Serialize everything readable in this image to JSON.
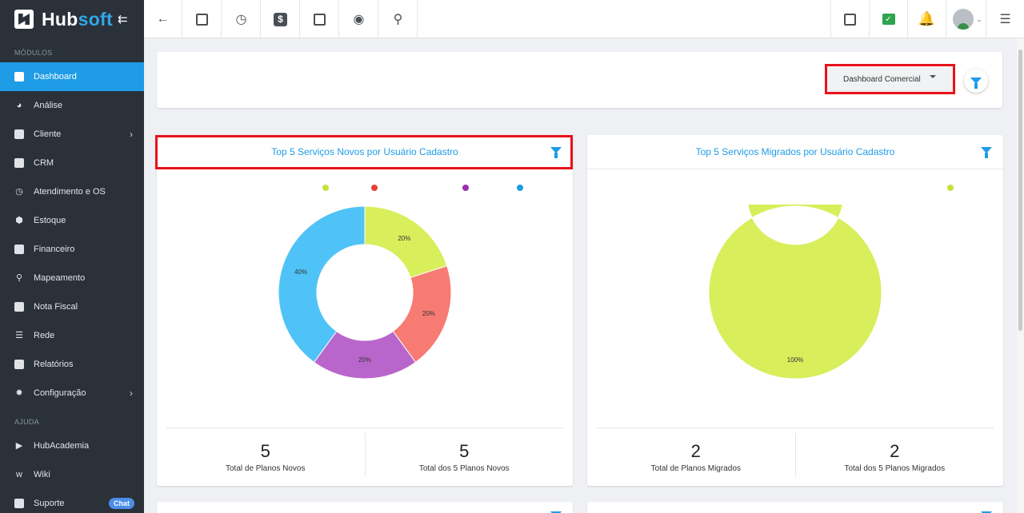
{
  "brand": {
    "name_part1": "Hub",
    "name_part2": "soft"
  },
  "sidebar": {
    "section_modules": "MÓDULOS",
    "section_help": "AJUDA",
    "items": [
      {
        "label": "Dashboard",
        "icon": "dashboard-icon"
      },
      {
        "label": "Análise",
        "icon": "pie-chart-icon"
      },
      {
        "label": "Cliente",
        "icon": "contact-card-icon"
      },
      {
        "label": "CRM",
        "icon": "crm-icon"
      },
      {
        "label": "Atendimento e OS",
        "icon": "calendar-clock-icon"
      },
      {
        "label": "Estoque",
        "icon": "box-icon"
      },
      {
        "label": "Financeiro",
        "icon": "money-icon"
      },
      {
        "label": "Mapeamento",
        "icon": "map-pin-icon"
      },
      {
        "label": "Nota Fiscal",
        "icon": "invoice-icon"
      },
      {
        "label": "Rede",
        "icon": "server-icon"
      },
      {
        "label": "Relatórios",
        "icon": "report-icon"
      },
      {
        "label": "Configuração",
        "icon": "gear-icon"
      }
    ],
    "help_items": [
      {
        "label": "HubAcademia",
        "icon": "video-icon"
      },
      {
        "label": "Wiki",
        "icon": "wiki-icon"
      },
      {
        "label": "Suporte",
        "icon": "chat-icon",
        "badge": "Chat"
      }
    ]
  },
  "filter": {
    "dashboard_select": "Dashboard Comercial"
  },
  "cards": [
    {
      "title": "Top 5 Serviços Novos por Usuário Cadastro",
      "stats": [
        {
          "value": "5",
          "label": "Total de Planos Novos"
        },
        {
          "value": "5",
          "label": "Total dos 5 Planos Novos"
        }
      ]
    },
    {
      "title": "Top 5 Serviços Migrados por Usuário Cadastro",
      "stats": [
        {
          "value": "2",
          "label": "Total de Planos Migrados"
        },
        {
          "value": "2",
          "label": "Total dos 5 Planos Migrados"
        }
      ]
    }
  ],
  "chart_data": [
    {
      "type": "pie",
      "donut": true,
      "title": "Top 5 Serviços Novos por Usuário Cadastro",
      "values": [
        20,
        20,
        20,
        40
      ],
      "labels": [
        "20%",
        "20%",
        "20%",
        "40%"
      ],
      "colors": [
        "#d8ee5b",
        "#f77b72",
        "#b966cc",
        "#4fc3f7"
      ],
      "legend_colors": [
        "#c6e23a",
        "#e84235",
        "#9b2fae",
        "#1e9ce6"
      ],
      "legend": "top"
    },
    {
      "type": "pie",
      "donut": true,
      "title": "Top 5 Serviços Migrados por Usuário Cadastro",
      "values": [
        100
      ],
      "labels": [
        "100%"
      ],
      "colors": [
        "#d8ee5b"
      ],
      "legend_colors": [
        "#c6e23a"
      ],
      "legend": "top"
    }
  ]
}
